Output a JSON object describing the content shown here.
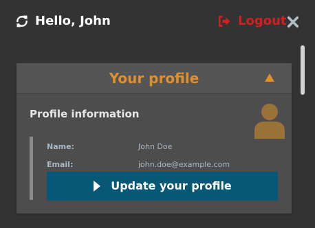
{
  "header": {
    "greeting": "Hello, John",
    "refresh_icon": "refresh-icon",
    "logout_label": "Logout",
    "logout_icon": "logout-arrow-icon",
    "close_icon": "close-x-icon"
  },
  "profile_panel": {
    "title": "Your profile",
    "toggle_icon": "caret-up-icon",
    "section_title": "Profile information",
    "avatar_icon": "user-avatar-icon",
    "fields": [
      {
        "label": "Name:",
        "value": "John Doe"
      },
      {
        "label": "Email:",
        "value": "john.doe@example.com"
      }
    ],
    "update_button_label": "Update your profile",
    "update_button_icon": "play-icon"
  },
  "colors": {
    "background": "#333333",
    "panel": "#4d4d4d",
    "panel_header": "#555555",
    "accent_orange": "#e0902a",
    "logout_red": "#d31f1f",
    "button_blue": "#075877",
    "muted_text": "#a7b7c8"
  }
}
